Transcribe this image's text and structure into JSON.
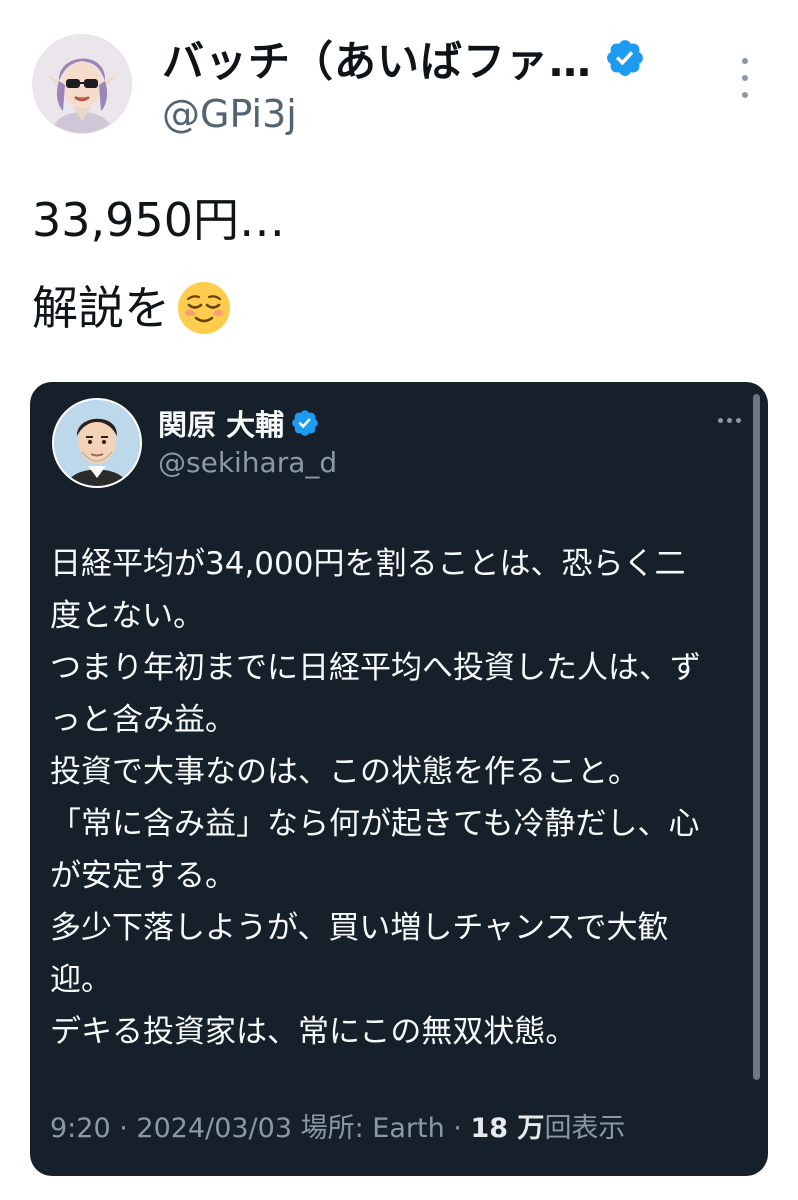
{
  "tweet": {
    "author": {
      "display_name": "バッチ（あいばファ…",
      "handle": "@GPi3j",
      "verified": true,
      "avatar_icon": "elf-avatar-icon"
    },
    "text_lines": [
      "33,950円…",
      "解説を"
    ],
    "emoji": "relieved-face-emoji"
  },
  "quoted_tweet": {
    "author": {
      "display_name": "関原 大輔",
      "handle": "@sekihara_d",
      "verified": true,
      "avatar_icon": "man-avatar-icon"
    },
    "text_lines": [
      "日経平均が34,000円を割ることは、恐らく二",
      "度とない。",
      "つまり年初までに日経平均へ投資した人は、ず",
      "っと含み益。",
      "投資で大事なのは、この状態を作ること。",
      "「常に含み益」なら何が起きても冷静だし、心",
      "が安定する。",
      "多少下落しようが、買い増しチャンスで大歓",
      "迎。",
      "デキる投資家は、常にこの無双状態。"
    ],
    "meta": {
      "time": "9:20",
      "date": "2024/03/03",
      "location": "場所: Earth",
      "views_count": "18 万",
      "views_label": "回表示",
      "separator": " · "
    }
  },
  "colors": {
    "verified_blue": "#1d9bf0",
    "card_background": "#15202b",
    "secondary_text": "#536471"
  }
}
